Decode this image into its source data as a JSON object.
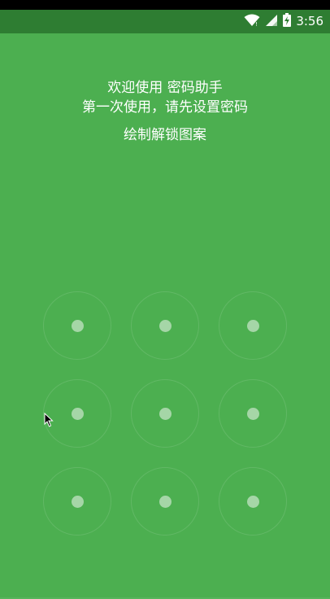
{
  "status_bar": {
    "time": "3:56",
    "icons": [
      "wifi-icon",
      "signal-icon",
      "battery-charging-icon"
    ]
  },
  "welcome": {
    "line1": "欢迎使用 密码助手",
    "line2": "第一次使用，请先设置密码",
    "instruction": "绘制解锁图案"
  },
  "colors": {
    "background": "#4caf50",
    "status_bar": "#2e7d32",
    "node_dot": "#a5d6a7"
  },
  "pattern": {
    "rows": 3,
    "cols": 3
  }
}
